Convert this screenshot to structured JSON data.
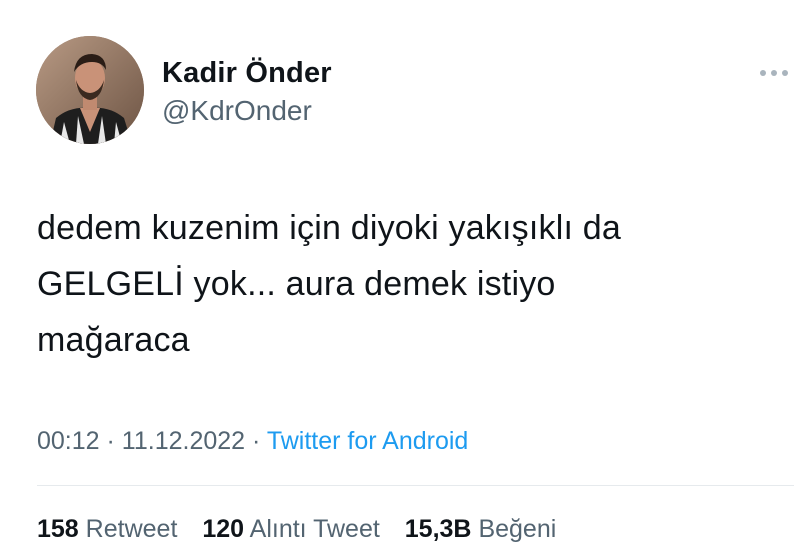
{
  "user": {
    "display_name": "Kadir Önder",
    "username": "@KdrOnder",
    "avatar_icon": "profile-photo"
  },
  "menu": {
    "icon": "more-horizontal-icon"
  },
  "tweet": {
    "text_lines": [
      "dedem kuzenim için diyoki yakışıklı da",
      "GELGELİ yok... aura demek istiyo",
      "mağaraca"
    ],
    "time": "00:12",
    "separator": "·",
    "date": "11.12.2022",
    "source": "Twitter for Android"
  },
  "stats": {
    "retweets_count": "158",
    "retweets_label": "Retweet",
    "quotes_count": "120",
    "quotes_label": "Alıntı Tweet",
    "likes_count": "15,3B",
    "likes_label": "Beğeni"
  },
  "colors": {
    "text": "#0f1419",
    "secondary": "#536471",
    "link": "#1d9bf0",
    "divider": "#e6eaed"
  }
}
